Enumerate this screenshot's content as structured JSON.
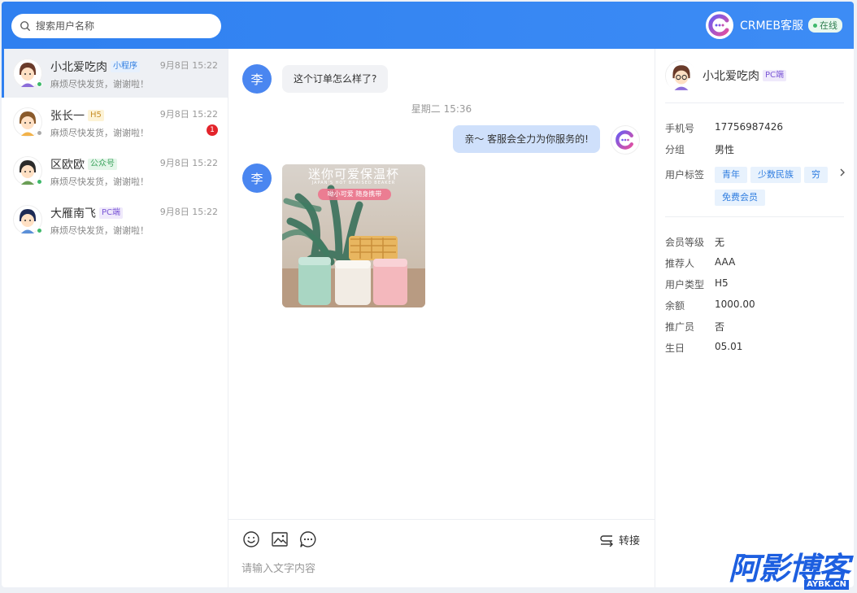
{
  "search": {
    "placeholder": "搜索用户名称"
  },
  "agent": {
    "name": "CRMEB客服",
    "status": "在线"
  },
  "colors": {
    "brand": "#2f80f0",
    "online": "#3fb96b",
    "offline": "#aaaaaa",
    "badge": "#e3242b"
  },
  "conversations": [
    {
      "name": "小北爱吃肉",
      "tag": "小程序",
      "preview": "麻烦尽快发货，谢谢啦！",
      "time": "9月8日 15:22",
      "unread": "",
      "online": true,
      "active": true
    },
    {
      "name": "张长一",
      "tag": "H5",
      "preview": "麻烦尽快发货，谢谢啦！",
      "time": "9月8日 15:22",
      "unread": "1",
      "online": false,
      "active": false
    },
    {
      "name": "区欧欧",
      "tag": "公众号",
      "preview": "麻烦尽快发货，谢谢啦！",
      "time": "9月8日 15:22",
      "unread": "",
      "online": true,
      "active": false
    },
    {
      "name": "大雁南飞",
      "tag": "PC端",
      "preview": "麻烦尽快发货，谢谢啦！",
      "time": "9月8日 15:22",
      "unread": "",
      "online": true,
      "active": false
    }
  ],
  "chat": {
    "customer_avatar_text": "李",
    "messages": [
      {
        "from": "customer",
        "type": "text",
        "text": "这个订单怎么样了?"
      },
      {
        "type": "time",
        "text": "星期二 15:36"
      },
      {
        "from": "agent",
        "type": "text",
        "text": "亲～ 客服会全力为你服务的!"
      },
      {
        "from": "customer",
        "type": "image",
        "image_texts": [
          "迷你可爱保温杯",
          "JAPAN'S HOT BRAISED BEAKER",
          "呦小可爱 随身携带"
        ]
      }
    ],
    "tools": [
      "emoji-icon",
      "image-icon",
      "quick-reply-icon"
    ],
    "transfer_label": "转接",
    "input_placeholder": "请输入文字内容"
  },
  "user": {
    "name": "小北爱吃肉",
    "tag": "PC端",
    "phone_label": "手机号",
    "phone": "17756987426",
    "group_label": "分组",
    "group": "男性",
    "tags_label": "用户标签",
    "tags": [
      "青年",
      "少数民族",
      "穷",
      "免费会员"
    ],
    "level_label": "会员等级",
    "level": "无",
    "referrer_label": "推荐人",
    "referrer": "AAA",
    "type_label": "用户类型",
    "type": "H5",
    "balance_label": "余额",
    "balance": "1000.00",
    "promoter_label": "推广员",
    "promoter": "否",
    "birthday_label": "生日",
    "birthday": "05.01"
  },
  "watermark": {
    "text": "阿影博客",
    "sub": "AYBK.CN"
  }
}
